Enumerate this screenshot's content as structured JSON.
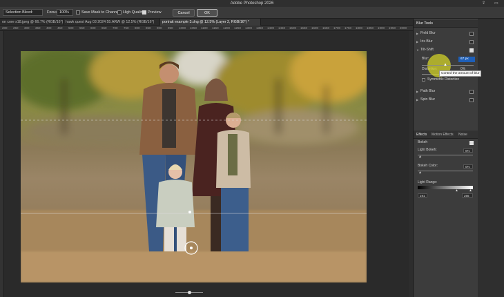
{
  "app": {
    "title": "Adobe Photoshop 2026"
  },
  "options_bar": {
    "selection_bleed_label": "Selection Bleed:",
    "focus_label": "Focus:",
    "focus_value": "100%",
    "save_mask_label": "Save Mask to Channels",
    "high_quality_label": "High Quality",
    "preview_label": "Preview",
    "preview_checked": true,
    "cancel_label": "Cancel",
    "ok_label": "OK"
  },
  "tabs": [
    {
      "label": "on core s18.jpeg @ 66.7% (RGB/16*)",
      "active": false
    },
    {
      "label": "hawk quest Aug 03 2024 55.ARW @ 12.5% (RGB/16*)",
      "active": false
    },
    {
      "label": "portrait example 3.dng @ 12.5% (Layer 2, RGB/16*) *",
      "active": true
    }
  ],
  "ruler_numbers": [
    "200",
    "250",
    "300",
    "350",
    "400",
    "450",
    "500",
    "550",
    "600",
    "650",
    "700",
    "750",
    "800",
    "850",
    "900",
    "950",
    "1000",
    "1050",
    "1100",
    "1150",
    "1200",
    "1250",
    "1300",
    "1350",
    "1400",
    "1450",
    "1500",
    "1550",
    "1600",
    "1650",
    "1700",
    "1750",
    "1800",
    "1850",
    "1900",
    "1950",
    "2000"
  ],
  "blur_tools": {
    "title": "Blur Tools",
    "field_blur": {
      "label": "Field Blur",
      "checked": false
    },
    "iris_blur": {
      "label": "Iris Blur",
      "checked": false
    },
    "tilt_shift": {
      "label": "Tilt-Shift",
      "checked": true
    },
    "blur_label": "Blur:",
    "blur_value": "67 px",
    "distortion_label": "Distortion:",
    "distortion_value": "0%",
    "symmetric_label": "Symmetric Distortion",
    "path_blur": {
      "label": "Path Blur",
      "checked": false
    },
    "spin_blur": {
      "label": "Spin Blur",
      "checked": false
    },
    "tooltip": "Control the amount of blur"
  },
  "effects": {
    "tabs": [
      "Effects",
      "Motion Effects",
      "Noise"
    ],
    "bokeh_label": "Bokeh",
    "bokeh_checked": true,
    "light_bokeh_label": "Light Bokeh:",
    "light_bokeh_value": "0%",
    "bokeh_color_label": "Bokeh Color:",
    "bokeh_color_value": "0%",
    "light_range_label": "Light Range:",
    "light_range_low": "191",
    "light_range_high": "255"
  }
}
